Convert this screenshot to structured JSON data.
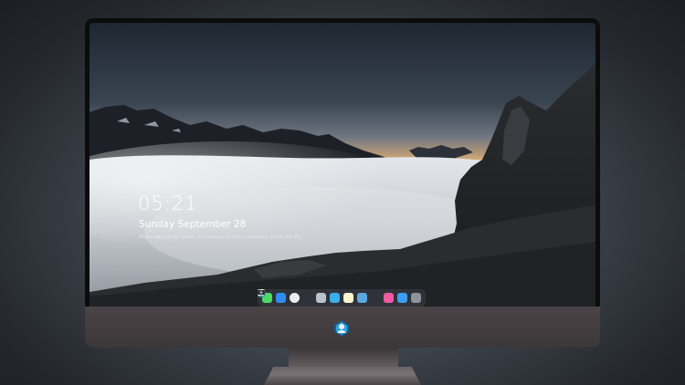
{
  "lockscreen": {
    "time": "05:21",
    "date": "Sunday September  28",
    "hint": "Please swipe up the screen, if cannot you to start (Instructions, add to this 35)"
  },
  "dock": {
    "items": [
      {
        "name": "messages-icon",
        "glyph": "",
        "color": "#4cd964"
      },
      {
        "name": "files-icon",
        "glyph": "",
        "color": "#2f8cf2"
      },
      {
        "name": "safari-icon",
        "glyph": "",
        "color": "#e9eef3"
      },
      {
        "name": "preview-icon",
        "glyph": "",
        "color": "#b9c3cc"
      },
      {
        "name": "video-editor-icon",
        "glyph": "",
        "color": "#39aee8"
      },
      {
        "name": "notes-icon",
        "glyph": "",
        "color": "#f5d74a"
      },
      {
        "name": "photos-icon",
        "glyph": "",
        "color": "#5aa8df"
      },
      {
        "name": "music-icon",
        "glyph": "",
        "color": "#f25aa6"
      },
      {
        "name": "app-store-icon",
        "glyph": "",
        "color": "#3d9ef2"
      },
      {
        "name": "camera-icon",
        "glyph": "",
        "color": "#8d949b"
      }
    ]
  },
  "colors": {
    "bezel": "#0c0c0d",
    "chin": "#4b4446",
    "sky_glow": "#d6aa7c"
  }
}
